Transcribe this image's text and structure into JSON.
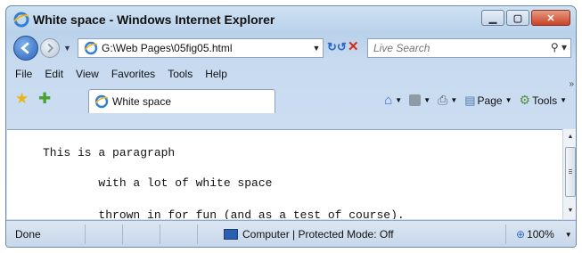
{
  "window": {
    "title": "White space - Windows Internet Explorer"
  },
  "navigation": {
    "address": "G:\\Web Pages\\05fig05.html",
    "search_placeholder": "Live Search"
  },
  "menu": {
    "items": [
      "File",
      "Edit",
      "View",
      "Favorites",
      "Tools",
      "Help"
    ]
  },
  "tabs": [
    {
      "label": "White space"
    }
  ],
  "command_bar": {
    "page_label": "Page",
    "tools_label": "Tools"
  },
  "content": {
    "lines": [
      "This is a paragraph",
      "        with a lot of white space",
      "        thrown in for fun (and as a test of course)."
    ]
  },
  "status": {
    "left": "Done",
    "zone": "Computer | Protected Mode: Off",
    "zoom": "100%"
  },
  "icons": {
    "back": "back-arrow-icon",
    "forward": "forward-arrow-icon",
    "refresh": "refresh-icon",
    "stop": "stop-icon",
    "search": "search-icon",
    "favorites": "favorites-star-icon",
    "add_favorites": "add-favorites-icon",
    "home": "home-icon",
    "feeds": "feeds-icon",
    "print": "print-icon"
  }
}
